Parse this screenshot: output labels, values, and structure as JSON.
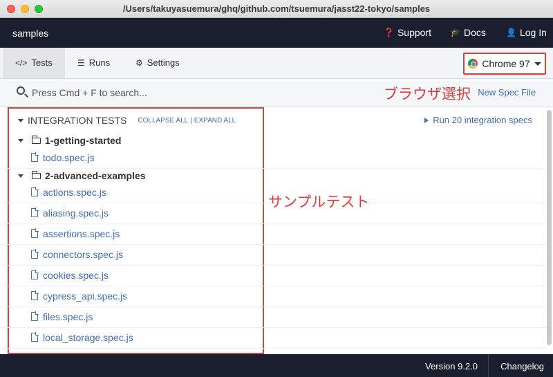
{
  "window": {
    "title": "/Users/takuyasuemura/ghq/github.com/tsuemura/jasst22-tokyo/samples"
  },
  "topnav": {
    "project": "samples",
    "support": "Support",
    "docs": "Docs",
    "login": "Log In"
  },
  "tabs": [
    {
      "label": "Tests",
      "icon": "code-icon",
      "active": true
    },
    {
      "label": "Runs",
      "icon": "database-icon",
      "active": false
    },
    {
      "label": "Settings",
      "icon": "gear-icon",
      "active": false
    }
  ],
  "browser": {
    "label": "Chrome 97",
    "icon": "chrome-icon"
  },
  "search": {
    "placeholder": "Press Cmd + F to search...",
    "new_spec": "New Spec File"
  },
  "annotations": {
    "browser_select": "ブラウザ選択",
    "sample_tests": "サンプルテスト"
  },
  "section": {
    "title": "INTEGRATION TESTS",
    "collapse_all": "COLLAPSE ALL",
    "sep": "|",
    "expand_all": "EXPAND ALL",
    "run_all": "Run 20 integration specs"
  },
  "folders": [
    {
      "name": "1-getting-started"
    },
    {
      "name": "2-advanced-examples"
    }
  ],
  "specs": [
    "todo.spec.js",
    "actions.spec.js",
    "aliasing.spec.js",
    "assertions.spec.js",
    "connectors.spec.js",
    "cookies.spec.js",
    "cypress_api.spec.js",
    "files.spec.js",
    "local_storage.spec.js"
  ],
  "footer": {
    "version": "Version 9.2.0",
    "changelog": "Changelog"
  },
  "colors": {
    "accent": "#3f6dba",
    "annotation": "#e23a3a",
    "dark": "#1b1e2e"
  }
}
